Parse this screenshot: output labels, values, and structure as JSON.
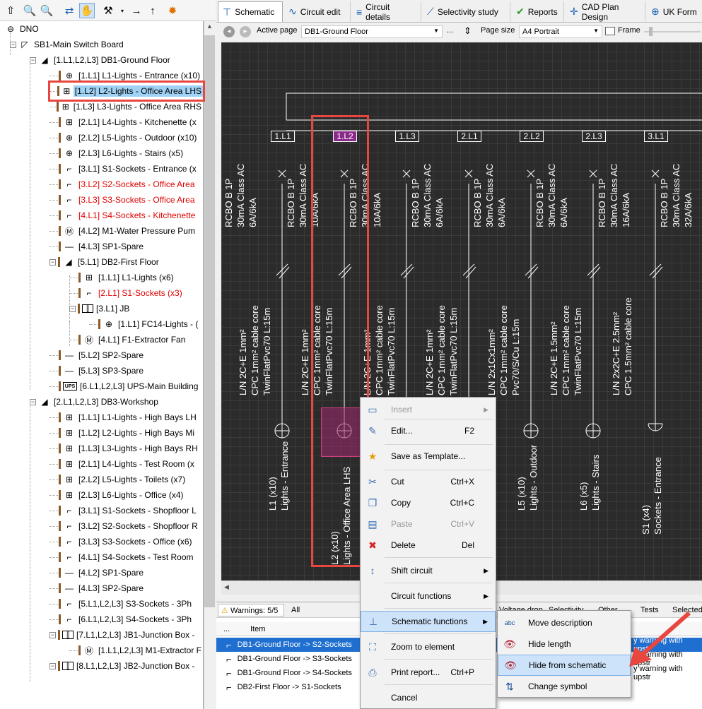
{
  "toolbar": {
    "icons": [
      "move-up-icon",
      "zoom-in-icon",
      "zoom-out-icon",
      "transfer-icon",
      "hand-icon",
      "tools-icon",
      "arrow-right-icon",
      "arrow-up-icon",
      "settings-sun-icon"
    ]
  },
  "tree": {
    "items": [
      {
        "label": "DNO",
        "sym": "⊖",
        "indent": 0,
        "exp": "",
        "red": false
      },
      {
        "label": "SB1-Main Switch Board",
        "sym": "◸",
        "indent": 1,
        "exp": "−",
        "red": false
      },
      {
        "label": "[1.L1,L2,L3] DB1-Ground Floor",
        "sym": "◢",
        "indent": 2,
        "exp": "−",
        "red": false
      },
      {
        "label": "[1.L1] L1-Lights - Entrance (x10)",
        "sym": "⊕",
        "indent": 3,
        "exp": "",
        "red": false
      },
      {
        "label": "[1.L2] L2-Lights - Office Area LHS",
        "sym": "⊞",
        "indent": 3,
        "exp": "",
        "red": false,
        "sel": true
      },
      {
        "label": "[1.L3] L3-Lights - Office Area RHS",
        "sym": "⊞",
        "indent": 3,
        "exp": "",
        "red": false
      },
      {
        "label": "[2.L1] L4-Lights - Kitchenette (x",
        "sym": "⊞",
        "indent": 3,
        "exp": "",
        "red": false
      },
      {
        "label": "[2.L2] L5-Lights - Outdoor (x10)",
        "sym": "⊕",
        "indent": 3,
        "exp": "",
        "red": false
      },
      {
        "label": "[2.L3] L6-Lights - Stairs (x5)",
        "sym": "⊕",
        "indent": 3,
        "exp": "",
        "red": false
      },
      {
        "label": "[3.L1] S1-Sockets - Entrance (x",
        "sym": "⌐",
        "indent": 3,
        "exp": "",
        "red": false
      },
      {
        "label": "[3.L2] S2-Sockets - Office Area",
        "sym": "⌐",
        "indent": 3,
        "exp": "",
        "red": true
      },
      {
        "label": "[3.L3] S3-Sockets - Office Area",
        "sym": "⌐",
        "indent": 3,
        "exp": "",
        "red": true
      },
      {
        "label": "[4.L1] S4-Sockets - Kitchenette",
        "sym": "⌐",
        "indent": 3,
        "exp": "",
        "red": true
      },
      {
        "label": "[4.L2] M1-Water Pressure Pum",
        "sym": "Ⓜ",
        "indent": 3,
        "exp": "",
        "red": false
      },
      {
        "label": "[4.L3] SP1-Spare",
        "sym": "—",
        "indent": 3,
        "exp": "",
        "red": false
      },
      {
        "label": "[5.L1] DB2-First Floor",
        "sym": "◢",
        "indent": 3,
        "exp": "−",
        "red": false
      },
      {
        "label": "[1.L1] L1-Lights (x6)",
        "sym": "⊞",
        "indent": 4,
        "exp": "",
        "red": false
      },
      {
        "label": "[2.L1] S1-Sockets (x3)",
        "sym": "⌐",
        "indent": 4,
        "exp": "",
        "red": true
      },
      {
        "label": "[3.L1] JB",
        "sym": "⫿",
        "indent": 4,
        "exp": "−",
        "red": false
      },
      {
        "label": "[1.L1] FC14-Lights - (",
        "sym": "⊕",
        "indent": 5,
        "exp": "",
        "red": false
      },
      {
        "label": "[4.L1] F1-Extractor Fan",
        "sym": "Ⓜ",
        "indent": 4,
        "exp": "",
        "red": false
      },
      {
        "label": "[5.L2] SP2-Spare",
        "sym": "—",
        "indent": 3,
        "exp": "",
        "red": false
      },
      {
        "label": "[5.L3] SP3-Spare",
        "sym": "—",
        "indent": 3,
        "exp": "",
        "red": false
      },
      {
        "label": "[6.L1,L2,L3] UPS-Main Building",
        "sym": "UPS",
        "indent": 3,
        "exp": "",
        "red": false
      },
      {
        "label": "[2.L1,L2,L3] DB3-Workshop",
        "sym": "◢",
        "indent": 2,
        "exp": "−",
        "red": false
      },
      {
        "label": "[1.L1] L1-Lights - High Bays LH",
        "sym": "⊞",
        "indent": 3,
        "exp": "",
        "red": false
      },
      {
        "label": "[1.L2] L2-Lights - High Bays Mi",
        "sym": "⊞",
        "indent": 3,
        "exp": "",
        "red": false
      },
      {
        "label": "[1.L3] L3-Lights - High Bays RH",
        "sym": "⊞",
        "indent": 3,
        "exp": "",
        "red": false
      },
      {
        "label": "[2.L1] L4-Lights - Test Room (x",
        "sym": "⊞",
        "indent": 3,
        "exp": "",
        "red": false
      },
      {
        "label": "[2.L2] L5-Lights - Toilets (x7)",
        "sym": "⊞",
        "indent": 3,
        "exp": "",
        "red": false
      },
      {
        "label": "[2.L3] L6-Lights - Office (x4)",
        "sym": "⊞",
        "indent": 3,
        "exp": "",
        "red": false
      },
      {
        "label": "[3.L1] S1-Sockets - Shopfloor L",
        "sym": "⌐",
        "indent": 3,
        "exp": "",
        "red": false
      },
      {
        "label": "[3.L2] S2-Sockets - Shopfloor R",
        "sym": "⌐",
        "indent": 3,
        "exp": "",
        "red": false
      },
      {
        "label": "[3.L3] S3-Sockets - Office (x6)",
        "sym": "⌐",
        "indent": 3,
        "exp": "",
        "red": false
      },
      {
        "label": "[4.L1] S4-Sockets - Test Room",
        "sym": "⌐",
        "indent": 3,
        "exp": "",
        "red": false
      },
      {
        "label": "[4.L2] SP1-Spare",
        "sym": "—",
        "indent": 3,
        "exp": "",
        "red": false
      },
      {
        "label": "[4.L3] SP2-Spare",
        "sym": "—",
        "indent": 3,
        "exp": "",
        "red": false
      },
      {
        "label": "[5.L1,L2,L3] S3-Sockets - 3Ph",
        "sym": "⌐",
        "indent": 3,
        "exp": "",
        "red": false
      },
      {
        "label": "[6.L1,L2,L3] S4-Sockets - 3Ph",
        "sym": "⌐",
        "indent": 3,
        "exp": "",
        "red": false
      },
      {
        "label": "[7.L1,L2,L3] JB1-Junction Box -",
        "sym": "⫿",
        "indent": 3,
        "exp": "−",
        "red": false
      },
      {
        "label": "[1.L1,L2,L3] M1-Extractor F",
        "sym": "Ⓜ",
        "indent": 4,
        "exp": "",
        "red": false
      },
      {
        "label": "[8.L1,L2,L3] JB2-Junction Box -",
        "sym": "⫿",
        "indent": 3,
        "exp": "−",
        "red": false
      }
    ]
  },
  "tabs": [
    {
      "label": "Schematic",
      "icon": "schematic-icon",
      "active": true
    },
    {
      "label": "Circuit edit",
      "icon": "circuit-edit-icon"
    },
    {
      "label": "Circuit details",
      "icon": "circuit-details-icon"
    },
    {
      "label": "Selectivity study",
      "icon": "selectivity-icon"
    },
    {
      "label": "Reports",
      "icon": "reports-icon"
    },
    {
      "label": "CAD Plan Design",
      "icon": "cad-icon"
    },
    {
      "label": "UK Form",
      "icon": "uk-flag-icon"
    }
  ],
  "page": {
    "active_label": "Active page",
    "active_value": "DB1-Ground Floor",
    "more": "...",
    "size_label": "Page size",
    "size_value": "A4 Portrait",
    "frame_label": "Frame"
  },
  "schematic": {
    "circuits": [
      {
        "id": "1.L1",
        "device": "RCBO B 1P\n30mA Class AC\n6A/6kA",
        "cable": "L/N 2C+E 1mm²\nCPC 1mm² cable core\nTwinFlatPvc70 L:15m",
        "load": "L1 (x10)\nLights - Entrance"
      },
      {
        "id": "1.L2",
        "device": "RCBO B 1P\n30mA Class AC\n10A/6kA",
        "cable": "L/N 2C+E 1mm²\nCPC 1mm² cable core\nTwinFlatPvc70 L:15m",
        "load": "L2 (x10)\nLights - Office Area LHS"
      },
      {
        "id": "1.L3",
        "device": "RCBO B 1P\n30mA Class AC\n10A/6kA",
        "cable": "L/N 2C+E 1mm²\nCPC 1mm² cable core\nTwinFlatPvc70 L:15m",
        "load": ""
      },
      {
        "id": "2.L1",
        "device": "RCBO B 1P\n30mA Class AC\n6A/6kA",
        "cable": "L/N 2C+E 1mm²\nCPC 1mm² cable core\nTwinFlatPvc70 L:15m",
        "load": ""
      },
      {
        "id": "2.L2",
        "device": "RCBO B 1P\n30mA Class AC\n6A/6kA",
        "cable": "L/N 2x1Cx1mm²\nCPC 1mm² cable core\nPvc70/S/Cu L:15m",
        "load": "L5 (x10)\nLights - Outdoor"
      },
      {
        "id": "2.L3",
        "device": "RCBO B 1P\n30mA Class AC\n6A/6kA",
        "cable": "L/N 2C+E 1.5mm²\nCPC 1mm² cable core\nTwinFlatPvc70 L:15m",
        "load": "L6 (x5)\nLights - Stairs"
      },
      {
        "id": "3.L1",
        "device": "RCBO B 1P\n30mA Class AC\n16A/6kA",
        "cable": "L/N 2x2C+E 2.5mm²\nCPC 1.5mm² cable core",
        "load": "S1 (x4)\nSockets - Entrance"
      },
      {
        "id": "",
        "device": "RCBO B 1P\n30mA Class AC\n32A/6kA",
        "cable": "",
        "load": ""
      }
    ]
  },
  "bottom": {
    "warnings": "Warnings: 5/5",
    "all": "All",
    "tabs_right": [
      "Voltage drop",
      "Selectivity",
      "Other",
      "Tests",
      "Selected"
    ],
    "col_dots": "...",
    "col_item": "Item",
    "rows": [
      {
        "text": "DB1-Ground Floor -> S2-Sockets",
        "right": "y warning with upstr"
      },
      {
        "text": "DB1-Ground Floor -> S3-Sockets",
        "right": "y warning with upstr"
      },
      {
        "text": "DB1-Ground Floor -> S4-Sockets",
        "right": "y warning with upstr"
      },
      {
        "text": "DB2-First Floor -> S1-Sockets",
        "right": ""
      }
    ]
  },
  "context_menu": [
    {
      "label": "Insert",
      "shortcut": "",
      "arrow": true,
      "disabled": true,
      "icon": "insert-icon"
    },
    {
      "label": "Edit...",
      "shortcut": "F2",
      "icon": "edit-pencil-icon"
    },
    {
      "label": "Save as Template...",
      "shortcut": "",
      "icon": "star-icon"
    },
    {
      "label": "Cut",
      "shortcut": "Ctrl+X",
      "icon": "scissors-icon"
    },
    {
      "label": "Copy",
      "shortcut": "Ctrl+C",
      "icon": "copy-icon"
    },
    {
      "label": "Paste",
      "shortcut": "Ctrl+V",
      "disabled": true,
      "icon": "paste-icon"
    },
    {
      "label": "Delete",
      "shortcut": "Del",
      "icon": "delete-icon"
    },
    {
      "label": "Shift circuit",
      "arrow": true,
      "icon": "shift-icon"
    },
    {
      "label": "Circuit functions",
      "arrow": true,
      "icon": ""
    },
    {
      "label": "Schematic functions",
      "arrow": true,
      "highlight": true,
      "icon": "schematic-functions-icon"
    },
    {
      "label": "Zoom to element",
      "icon": "zoom-element-icon"
    },
    {
      "label": "Print report...",
      "shortcut": "Ctrl+P",
      "icon": "printer-icon"
    },
    {
      "label": "Cancel",
      "icon": ""
    }
  ],
  "submenu": [
    {
      "label": "Move description",
      "icon": "move-description-icon"
    },
    {
      "label": "Hide length",
      "icon": "hide-length-icon"
    },
    {
      "label": "Hide from schematic",
      "icon": "hide-eye-icon",
      "highlight": true
    },
    {
      "label": "Change symbol",
      "icon": "change-symbol-icon"
    }
  ],
  "colors": {
    "highlight_red": "#e8463f",
    "selection_blue": "#1f6fd0",
    "canvas": "#2b2b2b",
    "menu_highlight": "#cde3f9"
  }
}
